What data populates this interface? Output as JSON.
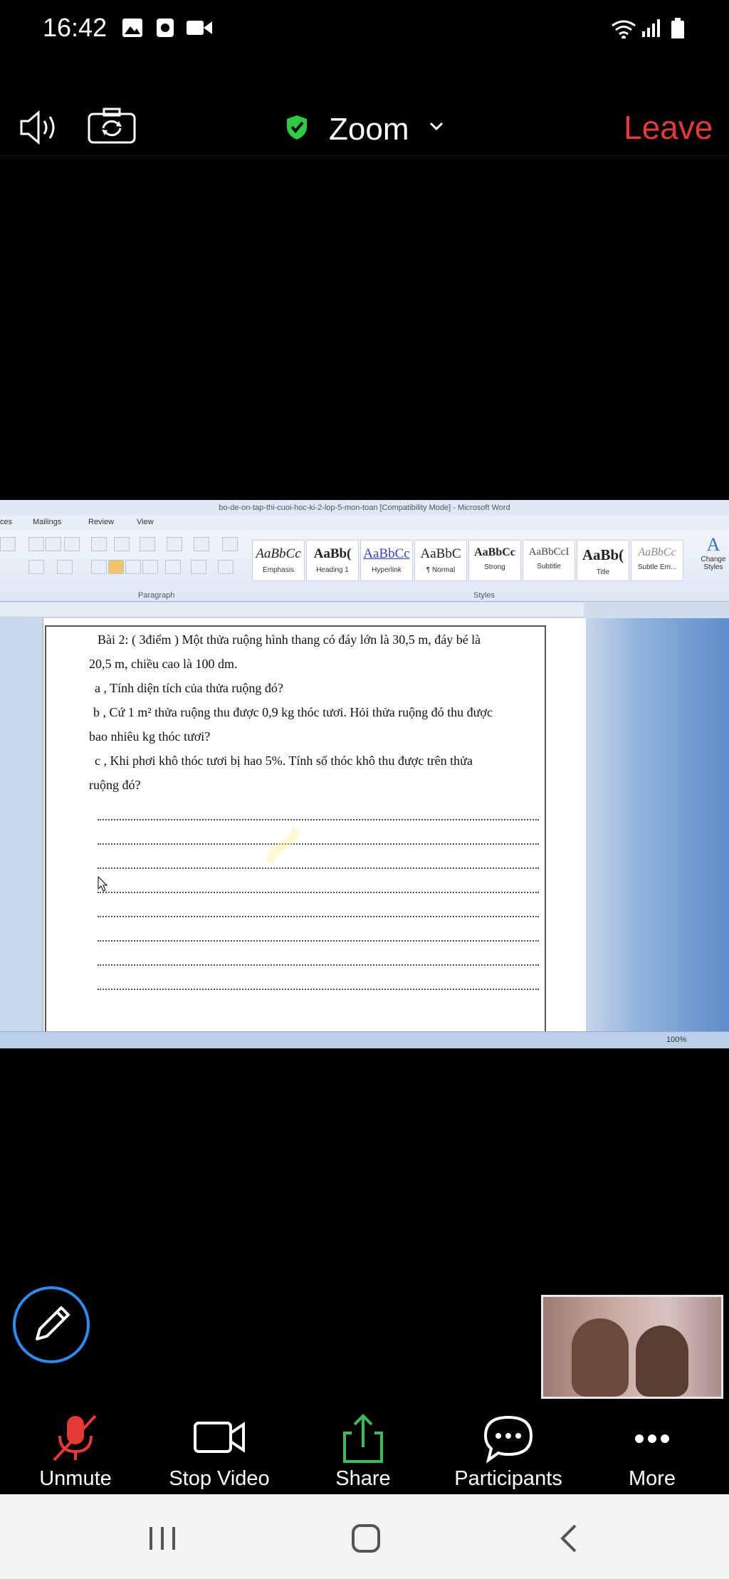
{
  "status_bar": {
    "time": "16:42"
  },
  "top_bar": {
    "meeting_title": "Zoom",
    "leave_label": "Leave"
  },
  "word": {
    "title": "bo-de-on-tap-thi-cuoi-hoc-ki-2-lop-5-mon-toan [Compatibility Mode] - Microsoft Word",
    "tabs": [
      "ces",
      "Mailings",
      "Review",
      "View"
    ],
    "styles": [
      {
        "sample": "AaBbCc",
        "name": "Emphasis"
      },
      {
        "sample": "AaBb(",
        "name": "Heading 1"
      },
      {
        "sample": "AaBbCc",
        "name": "Hyperlink"
      },
      {
        "sample": "AaBbC",
        "name": "¶ Normal"
      },
      {
        "sample": "AaBbCc",
        "name": "Strong"
      },
      {
        "sample": "AaBbCcI",
        "name": "Subtitle"
      },
      {
        "sample": "AaBb(",
        "name": "Title"
      },
      {
        "sample": "AaBbCc",
        "name": "Subtle Em..."
      }
    ],
    "change_styles_label": "Change Styles",
    "group_labels": {
      "paragraph": "Paragraph",
      "styles": "Styles"
    },
    "doc_lines": [
      "Bài 2: ( 3điểm ) Một thửa ruộng hình thang có đáy lớn là 30,5 m, đáy bé là",
      "20,5 m, chiều cao là 100 dm.",
      "a , Tính diện tích của thửa ruộng đó?",
      "b , Cứ 1 m² thửa ruộng thu được 0,9 kg thóc tươi. Hỏi thửa ruộng đó thu được",
      "bao nhiêu kg thóc tươi?",
      "c , Khi phơi khô thóc tươi bị hao 5%. Tính số thóc khô thu được trên thửa",
      "ruộng đó?"
    ],
    "zoom_level": "100%"
  },
  "toolbar": {
    "unmute_label": "Unmute",
    "stop_video_label": "Stop Video",
    "share_label": "Share",
    "participants_label": "Participants",
    "more_label": "More"
  },
  "colors": {
    "leave": "#e53935",
    "share_green": "#3dbb5a",
    "muted_red": "#e53935",
    "annotate_blue": "#2d8cf0"
  }
}
